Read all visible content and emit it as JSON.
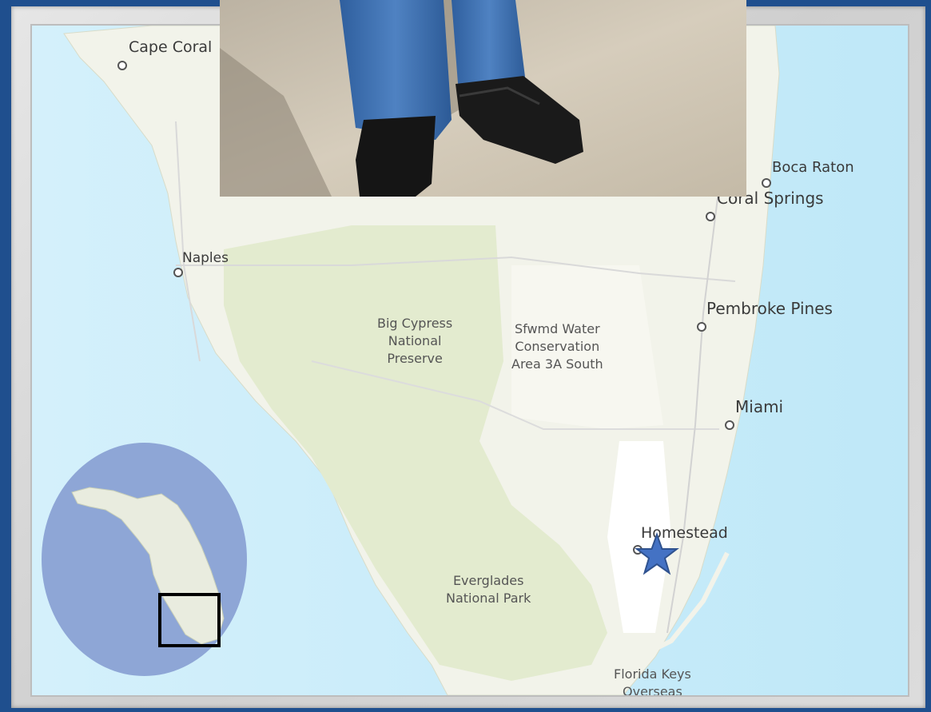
{
  "map": {
    "colors": {
      "water": "#cdeefa",
      "land": "#f3f4ea",
      "park": "#e4ecd0",
      "frame": "#1f4f8e",
      "inset_circle": "#8ea6d6",
      "star": "#4472c4"
    },
    "cities": [
      {
        "id": "cape-coral",
        "name": "Cape Coral"
      },
      {
        "id": "naples",
        "name": "Naples"
      },
      {
        "id": "boca-raton",
        "name": "Boca Raton"
      },
      {
        "id": "coral-springs",
        "name": "Coral Springs"
      },
      {
        "id": "pembroke-pines",
        "name": "Pembroke Pines"
      },
      {
        "id": "miami",
        "name": "Miami"
      },
      {
        "id": "homestead",
        "name": "Homestead"
      }
    ],
    "areas": [
      {
        "id": "big-cypress",
        "lines": [
          "Big Cypress",
          "National",
          "Preserve"
        ]
      },
      {
        "id": "sfwmd",
        "lines": [
          "Sfwmd Water",
          "Conservation",
          "Area 3A South"
        ]
      },
      {
        "id": "everglades",
        "lines": [
          "Everglades",
          "National Park"
        ]
      },
      {
        "id": "florida-keys",
        "lines": [
          "Florida Keys",
          "Overseas"
        ]
      }
    ],
    "marker": {
      "label": "star-marker",
      "near": "Homestead"
    }
  },
  "photo": {
    "subject": "person-wearing-jeans-and-black-sneakers"
  },
  "inset": {
    "region": "Florida",
    "highlight": "south-florida"
  }
}
